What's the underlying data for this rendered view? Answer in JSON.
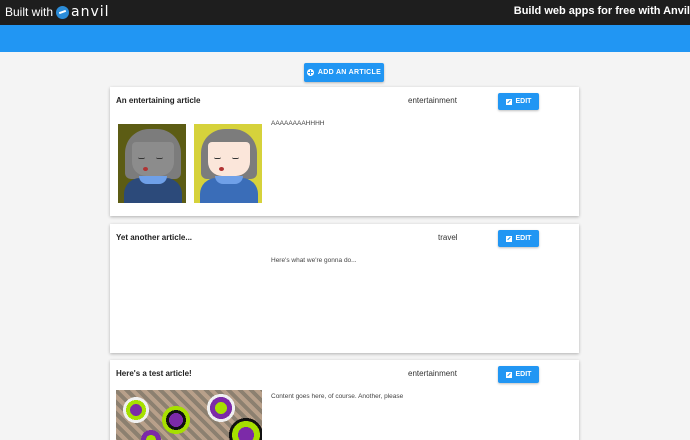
{
  "topbar": {
    "built_with": "Built with",
    "brand": "anvil",
    "tagline": "Build web apps for free with Anvil"
  },
  "toolbar": {
    "add_label": "ADD AN ARTICLE",
    "edit_label": "EDIT"
  },
  "articles": [
    {
      "title": "An entertaining article",
      "category": "entertainment",
      "content": "AAAAAAAAHHHH"
    },
    {
      "title": "Yet another article...",
      "category": "travel",
      "content": "Here's what we're gonna do..."
    },
    {
      "title": "Here's a test article!",
      "category": "entertainment",
      "content": "Content goes here, of course. Another, please"
    }
  ],
  "colors": {
    "accent": "#2196f3",
    "topbar": "#1e1e1e",
    "background": "#f4f4f4"
  }
}
